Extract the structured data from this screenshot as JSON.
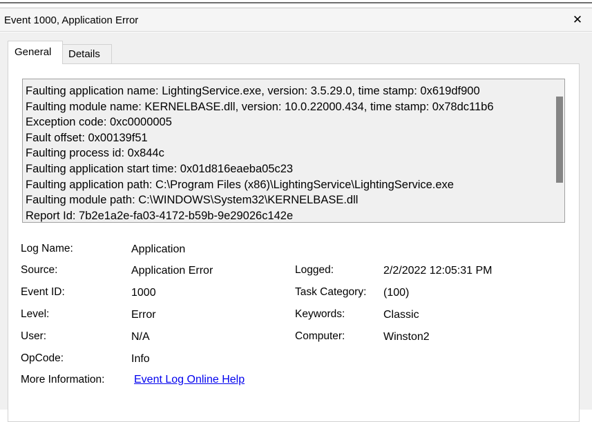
{
  "window": {
    "title": "Event 1000, Application Error",
    "close_symbol": "✕"
  },
  "tabs": [
    {
      "label": "General",
      "selected": true
    },
    {
      "label": "Details",
      "selected": false
    }
  ],
  "description_lines": [
    "Faulting application name: LightingService.exe, version: 3.5.29.0, time stamp: 0x619df900",
    "Faulting module name: KERNELBASE.dll, version: 10.0.22000.434, time stamp: 0x78dc11b6",
    "Exception code: 0xc0000005",
    "Fault offset: 0x00139f51",
    "Faulting process id: 0x844c",
    "Faulting application start time: 0x01d816eaeba05c23",
    "Faulting application path: C:\\Program Files (x86)\\LightingService\\LightingService.exe",
    "Faulting module path: C:\\WINDOWS\\System32\\KERNELBASE.dll",
    "Report Id: 7b2e1a2e-fa03-4172-b59b-9e29026c142e"
  ],
  "fields": {
    "log_name": {
      "label": "Log Name:",
      "value": "Application"
    },
    "source": {
      "label": "Source:",
      "value": "Application Error"
    },
    "event_id": {
      "label": "Event ID:",
      "value": "1000"
    },
    "level": {
      "label": "Level:",
      "value": "Error"
    },
    "user": {
      "label": "User:",
      "value": "N/A"
    },
    "opcode": {
      "label": "OpCode:",
      "value": "Info"
    },
    "more_info": {
      "label": "More Information:",
      "value": "Event Log Online Help"
    },
    "logged": {
      "label": "Logged:",
      "value": "2/2/2022 12:05:31 PM"
    },
    "task_category": {
      "label": "Task Category:",
      "value": "(100)"
    },
    "keywords": {
      "label": "Keywords:",
      "value": "Classic"
    },
    "computer": {
      "label": "Computer:",
      "value": "Winston2"
    }
  },
  "colors": {
    "link": "#0000ee",
    "dialog_background": "#f0f0f0",
    "panel_background": "#ffffff",
    "scrollbar_thumb": "#858585"
  }
}
